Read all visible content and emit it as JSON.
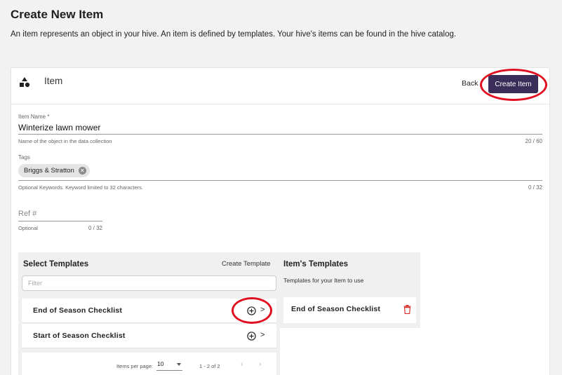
{
  "page": {
    "title": "Create New Item",
    "description": "An item represents an object in your hive. An item is defined by templates. Your hive's items can be found in the hive catalog."
  },
  "card": {
    "icon": "shapes-icon",
    "title": "Item",
    "back_label": "Back",
    "create_label": "Create Item"
  },
  "form": {
    "item_name": {
      "label": "Item Name *",
      "value": "Winterize lawn mower",
      "hint": "Name of the object in the data collection",
      "counter": "20 / 60"
    },
    "tags": {
      "label": "Tags",
      "chips": [
        "Briggs & Stratton"
      ],
      "hint": "Optional Keywords. Keyword limited to 32 characters.",
      "counter": "0 / 32"
    },
    "ref": {
      "placeholder": "Ref #",
      "hint": "Optional",
      "counter": "0 / 32"
    }
  },
  "select_templates": {
    "title": "Select Templates",
    "create_label": "Create Template",
    "filter_placeholder": "Filter",
    "rows": [
      {
        "name": "End of Season Checklist"
      },
      {
        "name": "Start of Season Checklist"
      }
    ],
    "pager": {
      "items_per_page_label": "Items per page:",
      "items_per_page": "10",
      "range": "1 - 2 of 2",
      "prev": "‹",
      "next": "›"
    }
  },
  "item_templates": {
    "title": "Item's Templates",
    "subtitle": "Templates for your Item to use",
    "rows": [
      {
        "name": "End of Season Checklist"
      }
    ]
  },
  "colors": {
    "primary_button": "#3a2d5a",
    "highlight": "#e01020",
    "delete": "#d8322c"
  }
}
